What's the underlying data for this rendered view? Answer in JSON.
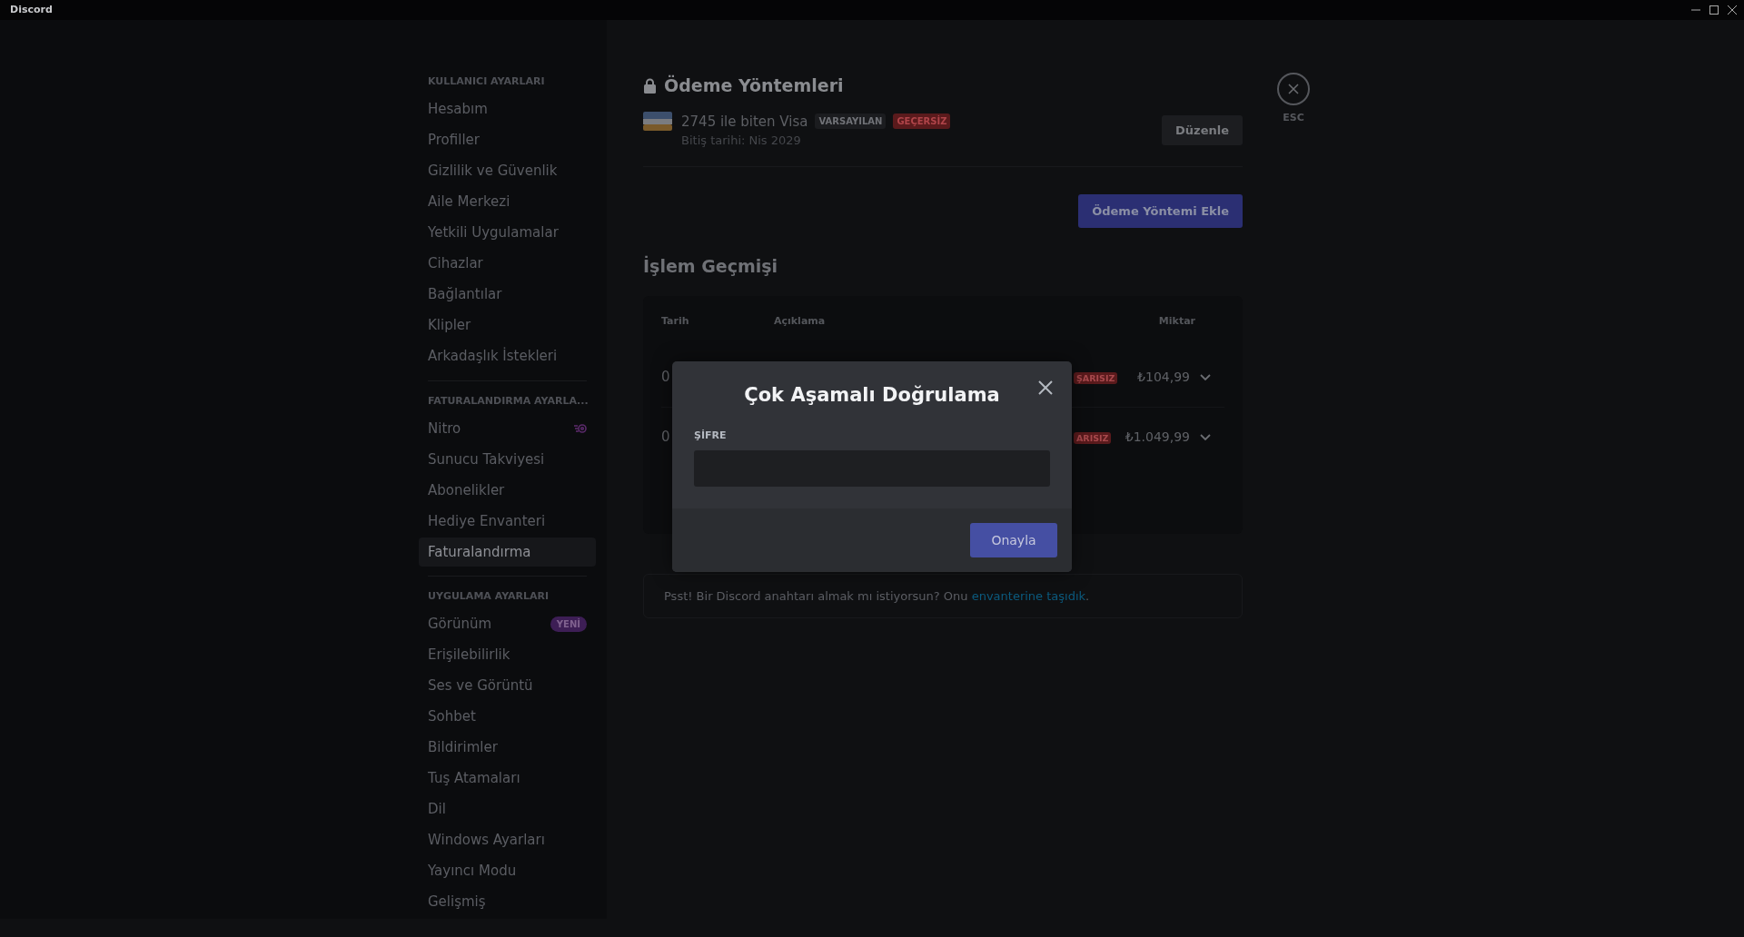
{
  "window": {
    "title": "Discord"
  },
  "sidebar": {
    "sections": [
      {
        "header": "KULLANICI AYARLARI",
        "items": [
          {
            "label": "Hesabım",
            "selected": false
          },
          {
            "label": "Profiller",
            "selected": false
          },
          {
            "label": "Gizlilik ve Güvenlik",
            "selected": false
          },
          {
            "label": "Aile Merkezi",
            "selected": false
          },
          {
            "label": "Yetkili Uygulamalar",
            "selected": false
          },
          {
            "label": "Cihazlar",
            "selected": false
          },
          {
            "label": "Bağlantılar",
            "selected": false
          },
          {
            "label": "Klipler",
            "selected": false
          },
          {
            "label": "Arkadaşlık İstekleri",
            "selected": false
          }
        ]
      },
      {
        "header": "FATURALANDIRMA AYARLA...",
        "items": [
          {
            "label": "Nitro",
            "selected": false,
            "kind": "nitro"
          },
          {
            "label": "Sunucu Takviyesi",
            "selected": false
          },
          {
            "label": "Abonelikler",
            "selected": false
          },
          {
            "label": "Hediye Envanteri",
            "selected": false
          },
          {
            "label": "Faturalandırma",
            "selected": true
          }
        ]
      },
      {
        "header": "UYGULAMA AYARLARI",
        "items": [
          {
            "label": "Görünüm",
            "selected": false,
            "badge": "YENİ"
          },
          {
            "label": "Erişilebilirlik",
            "selected": false
          },
          {
            "label": "Ses ve Görüntü",
            "selected": false
          },
          {
            "label": "Sohbet",
            "selected": false
          },
          {
            "label": "Bildirimler",
            "selected": false
          },
          {
            "label": "Tuş Atamaları",
            "selected": false
          },
          {
            "label": "Dil",
            "selected": false
          },
          {
            "label": "Windows Ayarları",
            "selected": false
          },
          {
            "label": "Yayıncı Modu",
            "selected": false
          },
          {
            "label": "Gelişmiş",
            "selected": false
          }
        ]
      }
    ]
  },
  "payment_methods": {
    "title": "Ödeme Yöntemleri",
    "cards": [
      {
        "name": "2745 ile biten Visa",
        "tags": [
          {
            "label": "VARSAYILAN",
            "kind": "neutral"
          },
          {
            "label": "GEÇERSİZ",
            "kind": "danger"
          }
        ],
        "expiry": "Bitiş tarihi: Nis 2029",
        "edit_button": "Düzenle"
      }
    ],
    "add_button": "Ödeme Yöntemi Ekle"
  },
  "transactions": {
    "title": "İşlem Geçmişi",
    "columns": [
      "Tarih",
      "Açıklama",
      "Miktar"
    ],
    "rows": [
      {
        "date": "0",
        "status": "ŞARISIZ",
        "amount": "₺104,99",
        "expanded": false
      },
      {
        "date": "0",
        "status": "ARISIZ",
        "amount": "₺1.049,99",
        "expanded": false
      }
    ]
  },
  "notice": {
    "text": "Psst! Bir Discord anahtarı almak mı istiyorsun? Onu ",
    "link": "envanterine taşıdık",
    "suffix": "."
  },
  "close": {
    "label": "ESC"
  },
  "modal": {
    "title": "Çok Aşamalı Doğrulama",
    "field_label": "ŞİFRE",
    "confirm_button": "Onayla"
  }
}
